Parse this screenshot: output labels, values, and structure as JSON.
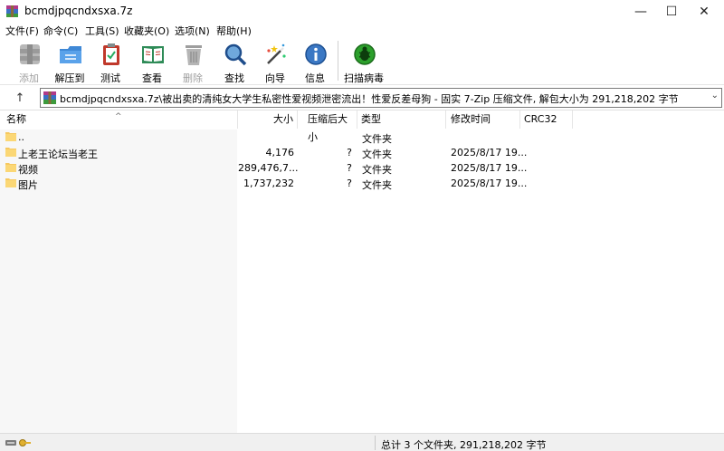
{
  "window": {
    "title": "bcmdjpqcndxsxa.7z",
    "minimize": "—",
    "maximize": "☐",
    "close": "✕"
  },
  "menu": [
    "文件(F)",
    "命令(C)",
    "工具(S)",
    "收藏夹(O)",
    "选项(N)",
    "帮助(H)"
  ],
  "toolbar": {
    "add": "添加",
    "extract": "解压到",
    "test": "测试",
    "view": "查看",
    "delete": "删除",
    "find": "查找",
    "wizard": "向导",
    "info": "信息",
    "scan": "扫描病毒"
  },
  "address": {
    "path": "bcmdjpqcndxsxa.7z\\被出卖的清纯女大学生私密性爱视频泄密流出！性爱反差母狗 - 固实 7-Zip 压缩文件, 解包大小为 291,218,202 字节",
    "up_arrow": "↑",
    "dropdown_arrow": "⌄"
  },
  "columns": {
    "name": "名称",
    "size": "大小",
    "packed": "压缩后大小",
    "type": "类型",
    "modified": "修改时间",
    "crc": "CRC32"
  },
  "rows": [
    {
      "name": "..",
      "size": "",
      "packed": "",
      "type": "文件夹",
      "modified": ""
    },
    {
      "name": "上老王论坛当老王",
      "size": "4,176",
      "packed": "?",
      "type": "文件夹",
      "modified": "2025/8/17 19..."
    },
    {
      "name": "视频",
      "size": "289,476,7...",
      "packed": "?",
      "type": "文件夹",
      "modified": "2025/8/17 19..."
    },
    {
      "name": "图片",
      "size": "1,737,232",
      "packed": "?",
      "type": "文件夹",
      "modified": "2025/8/17 19..."
    }
  ],
  "status": {
    "summary": "总计 3 个文件夹, 291,218,202 字节"
  }
}
